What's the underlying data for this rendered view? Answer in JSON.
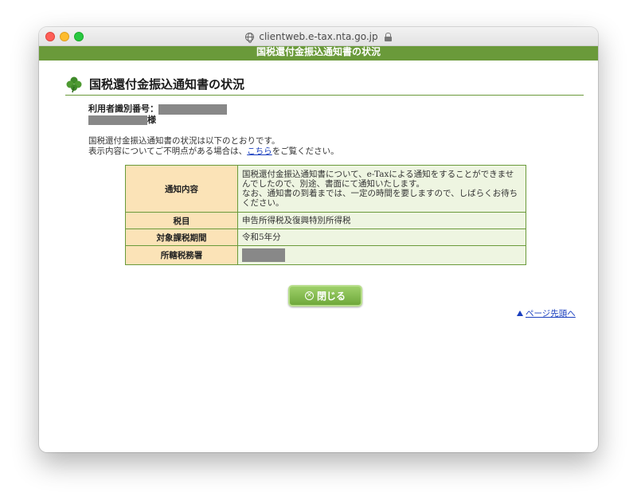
{
  "browser": {
    "url": "clientweb.e-tax.nta.go.jp"
  },
  "header": {
    "banner_title": "国税還付金振込通知書の状況"
  },
  "page": {
    "heading": "国税還付金振込通知書の状況",
    "user_id_label": "利用者識別番号：",
    "honorific": "様",
    "intro_line1": "国税還付金振込通知書の状況は以下のとおりです。",
    "intro_line2_before": "表示内容についてご不明点がある場合は、",
    "intro_link": "こちら",
    "intro_line2_after": "をご覧ください。"
  },
  "table": {
    "rows": [
      {
        "label": "通知内容",
        "value": "国税還付金振込通知書について、e-Taxによる通知をすることができませんでしたので、別途、書面にて通知いたします。\nなお、通知書の到着までは、一定の時間を要しますので、しばらくお待ちください。"
      },
      {
        "label": "税目",
        "value": "申告所得税及復興特別所得税"
      },
      {
        "label": "対象課税期間",
        "value": "令和5年分"
      },
      {
        "label": "所轄税務署",
        "value": ""
      }
    ]
  },
  "actions": {
    "close_label": "閉じる",
    "page_top_label": "ページ先頭へ"
  },
  "colors": {
    "brand_green": "#6a9a3a",
    "label_bg": "#fbe3b7",
    "value_bg": "#eef5e1",
    "link": "#1a3fbf"
  }
}
